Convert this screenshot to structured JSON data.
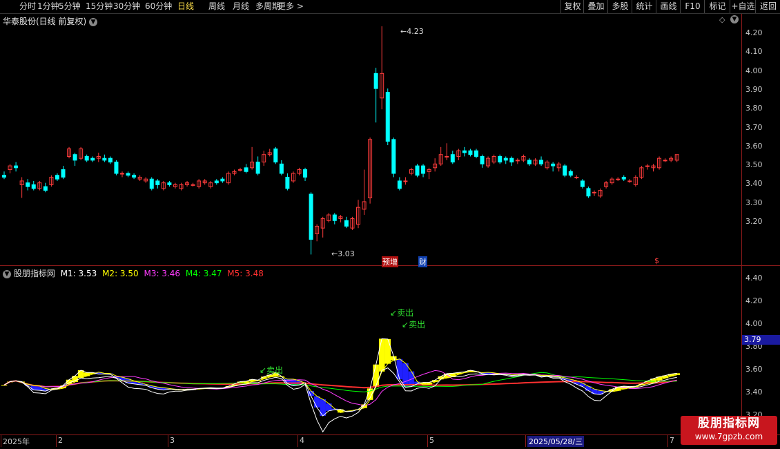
{
  "toolbar": {
    "periods": [
      "分时",
      "1分钟",
      "5分钟",
      "15分钟",
      "30分钟",
      "60分钟",
      "日线",
      "周线",
      "月线",
      "多周期",
      "更多 >"
    ],
    "active_period": "日线",
    "buttons": [
      "复权",
      "叠加",
      "多股",
      "统计",
      "画线",
      "F10",
      "标记",
      "+自选",
      "返回"
    ]
  },
  "main_chart": {
    "title": "华泰股份(日线 前复权)",
    "high_label": "4.23",
    "low_label": "3.03",
    "events": [
      "预增",
      "财",
      "$"
    ],
    "y_ticks": [
      "4.20",
      "4.10",
      "4.00",
      "3.90",
      "3.80",
      "3.70",
      "3.60",
      "3.50",
      "3.40",
      "3.30",
      "3.20"
    ]
  },
  "indicator": {
    "name": "股朋指标网",
    "m1": "M1: 3.53",
    "m2": "M2: 3.50",
    "m3": "M3: 3.46",
    "m4": "M4: 3.47",
    "m5": "M5: 3.48",
    "sell_label": "卖出",
    "y_ticks": [
      "4.40",
      "4.20",
      "4.00",
      "3.80",
      "3.60",
      "3.40",
      "3.20"
    ],
    "current_value": "3.79"
  },
  "dates": [
    "2025年",
    "2",
    "3",
    "4",
    "5",
    "2025/05/28/三",
    "7"
  ],
  "logo": {
    "title": "股朋指标网",
    "url": "www.7gpzb.com"
  },
  "colors": {
    "up": "#ff3c3c",
    "down": "#00ffff",
    "axis": "#8b1a1a",
    "m1": "#ffffff",
    "m2": "#ffff00",
    "m3": "#ff3cff",
    "m4": "#00ff00",
    "m5": "#ff3030"
  }
}
